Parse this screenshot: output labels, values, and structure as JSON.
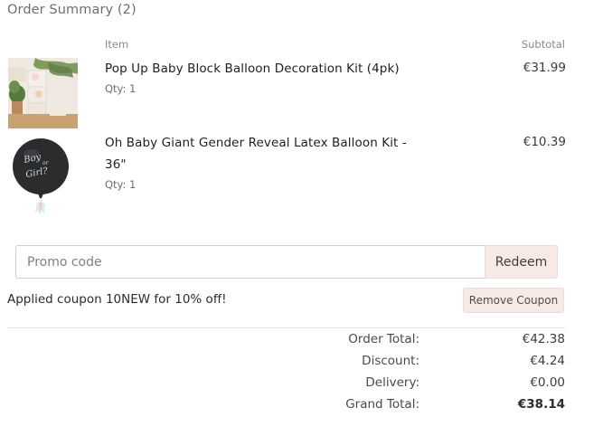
{
  "summary": {
    "title": "Order Summary (2)",
    "col_item": "Item",
    "col_subtotal": "Subtotal"
  },
  "items": [
    {
      "name": "Pop Up Baby Block Balloon Decoration Kit (4pk)",
      "qty": "Qty: 1",
      "subtotal": "€31.99",
      "image_icon": "balloon-blocks-photo-icon"
    },
    {
      "name": "Oh Baby Giant Gender Reveal Latex Balloon Kit - 36\"",
      "qty": "Qty: 1",
      "subtotal": "€10.39",
      "image_icon": "black-balloon-photo-icon",
      "image_text": [
        "Boy",
        "or",
        "Girl?"
      ]
    }
  ],
  "promo": {
    "placeholder": "Promo code",
    "value": "",
    "redeem_label": "Redeem"
  },
  "coupon": {
    "message": "Applied coupon 10NEW for 10% off!",
    "remove_label": "Remove Coupon"
  },
  "totals": {
    "order_total_label": "Order Total:",
    "order_total_value": "€42.38",
    "discount_label": "Discount:",
    "discount_value": "€4.24",
    "delivery_label": "Delivery:",
    "delivery_value": "€0.00",
    "grand_total_label": "Grand Total:",
    "grand_total_value": "€38.14"
  },
  "colors": {
    "button_bg": "#f6e9e6",
    "text": "#2d2b2b",
    "muted": "#6e6e6e"
  }
}
